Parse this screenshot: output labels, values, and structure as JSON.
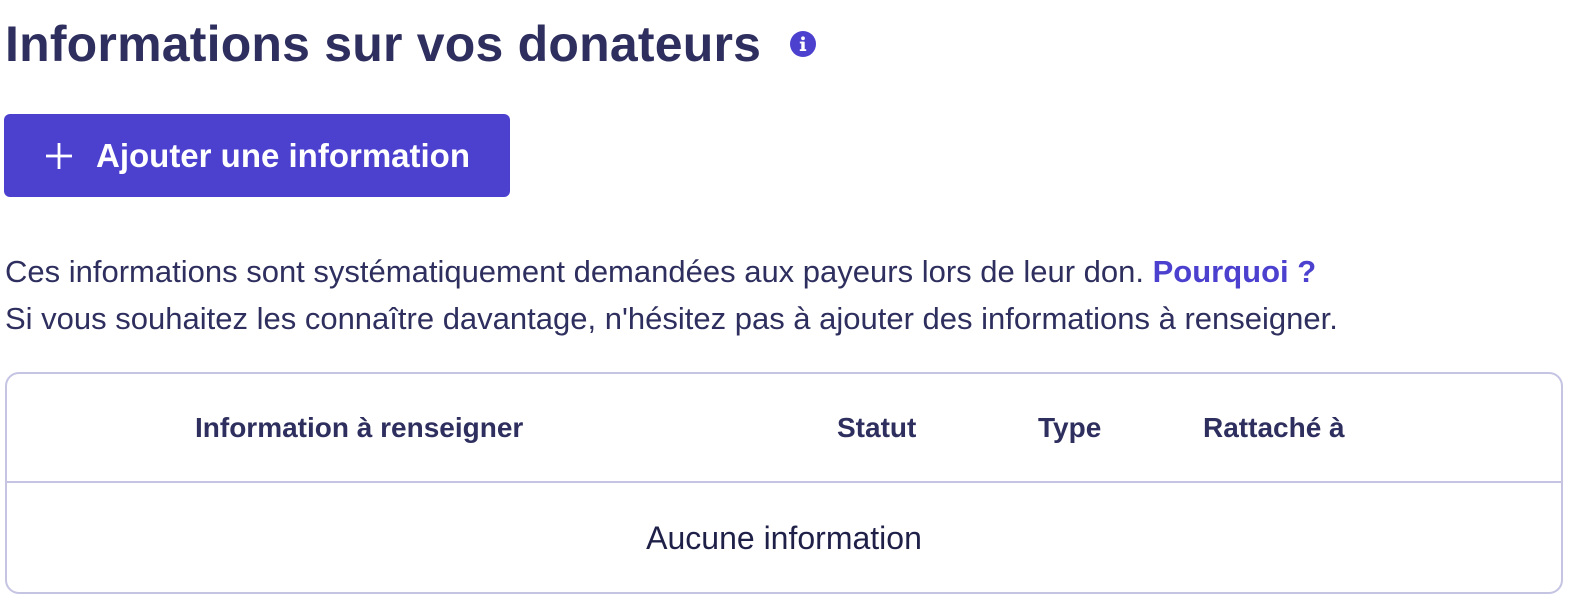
{
  "header": {
    "title": "Informations sur vos donateurs",
    "info_icon": "info-circle-icon"
  },
  "add_button": {
    "label": "Ajouter une information",
    "icon": "plus-icon"
  },
  "description": {
    "line1": "Ces informations sont systématiquement demandées aux payeurs lors de leur don.",
    "why_link": "Pourquoi ?",
    "line2": "Si vous souhaitez les connaître davantage, n'hésitez pas à ajouter des informations à renseigner."
  },
  "table": {
    "columns": [
      "Information à renseigner",
      "Statut",
      "Type",
      "Rattaché à"
    ],
    "rows": [],
    "empty_message": "Aucune information"
  },
  "colors": {
    "primary": "#4c40cf",
    "text": "#2e2f5e",
    "border": "#c5c4e3"
  }
}
